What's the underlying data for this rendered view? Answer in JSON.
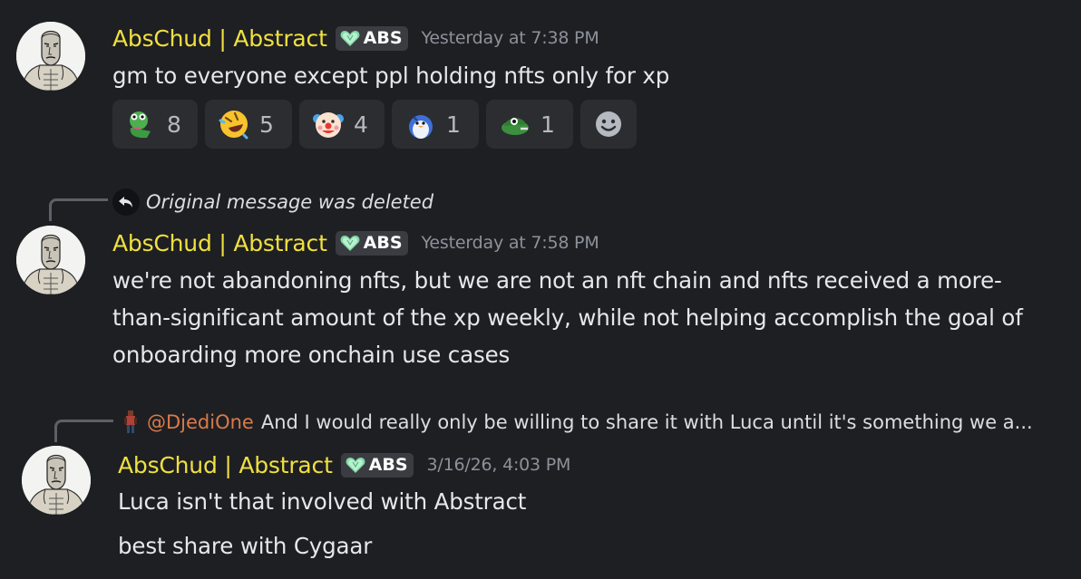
{
  "messages": [
    {
      "author": "AbsChud | Abstract",
      "tag": "ABS",
      "timestamp": "Yesterday at 7:38 PM",
      "text": "gm to everyone except ppl holding nfts only for xp",
      "reactions": [
        {
          "emoji": "pepe-heart-emoji",
          "count": "8"
        },
        {
          "emoji": "rolling-laughing-emoji",
          "count": "5"
        },
        {
          "emoji": "clown-face-emoji",
          "count": "4"
        },
        {
          "emoji": "penguin-emoji",
          "count": "1"
        },
        {
          "emoji": "frog-cap-emoji",
          "count": "1"
        }
      ]
    },
    {
      "reply_text": "Original message was deleted",
      "author": "AbsChud | Abstract",
      "tag": "ABS",
      "timestamp": "Yesterday at 7:58 PM",
      "lines": [
        "we're not abandoning nfts, but we are not an nft chain and nfts received a more-",
        "than-significant amount of the xp weekly, while not helping accomplish the goal of",
        "onboarding more onchain use cases"
      ]
    },
    {
      "reply_mention": "@DjediOne",
      "reply_text": "And I would really only be willing to share it with Luca until it's something we a...",
      "author": "AbsChud | Abstract",
      "tag": "ABS",
      "timestamp": "3/16/26, 4:03 PM",
      "lines": [
        "Luca isn't that involved with Abstract",
        "best share with Cygaar"
      ]
    }
  ],
  "colors": {
    "background": "#1e1f23",
    "username": "#f0e040",
    "mention": "#d97a49",
    "timestamp": "#8d9199"
  }
}
